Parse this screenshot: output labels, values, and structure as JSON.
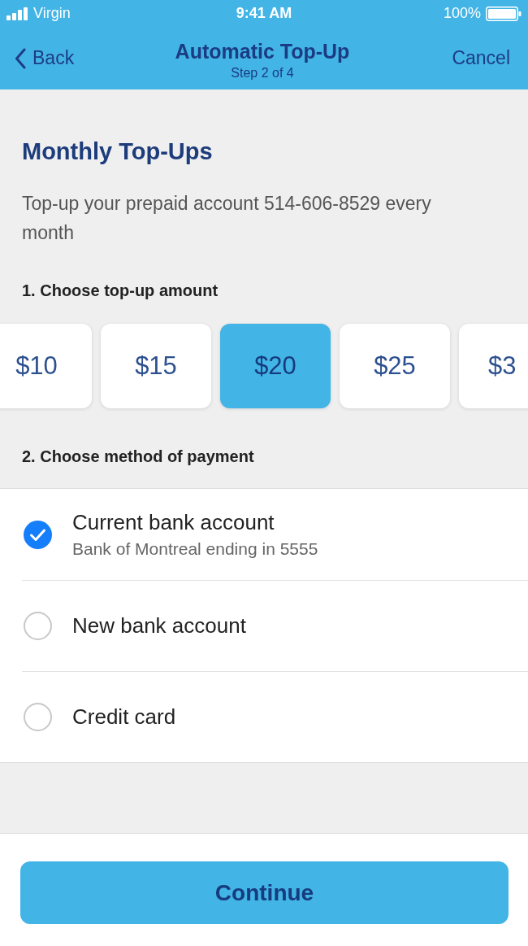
{
  "status_bar": {
    "carrier": "Virgin",
    "time": "9:41 AM",
    "battery": "100%"
  },
  "nav": {
    "back": "Back",
    "title": "Automatic Top-Up",
    "subtitle": "Step 2 of 4",
    "cancel": "Cancel"
  },
  "heading": "Monthly Top-Ups",
  "description": "Top-up your prepaid account 514-606-8529 every month",
  "amount_section": {
    "label": "1. Choose top-up amount",
    "amounts": [
      {
        "label": "$10",
        "selected": false
      },
      {
        "label": "$15",
        "selected": false
      },
      {
        "label": "$20",
        "selected": true
      },
      {
        "label": "$25",
        "selected": false
      },
      {
        "label": "$3",
        "selected": false
      }
    ]
  },
  "payment_section": {
    "label": "2. Choose method of payment",
    "methods": [
      {
        "title": "Current bank account",
        "detail": "Bank of Montreal ending in 5555",
        "selected": true
      },
      {
        "title": "New bank account",
        "selected": false
      },
      {
        "title": "Credit card",
        "selected": false
      }
    ]
  },
  "continue_button": "Continue"
}
